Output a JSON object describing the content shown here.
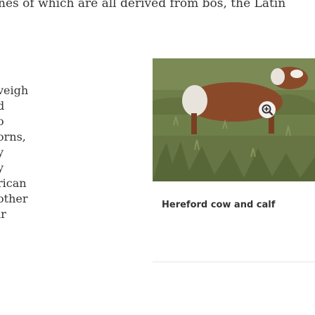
{
  "article": {
    "top_line": "nes of which are all derived from bos, the Latin",
    "column_fragments": [
      "veigh",
      "d",
      "o",
      "orns,",
      "y",
      "y",
      "rican",
      "",
      "other",
      "ir"
    ]
  },
  "figure": {
    "caption": "Hereford cow and calf",
    "expand_icon": "magnify-plus-icon",
    "colors": {
      "grass": "#6f7f49",
      "cattle_red": "#8a4a2a",
      "cattle_white": "#e8e4dc"
    }
  }
}
